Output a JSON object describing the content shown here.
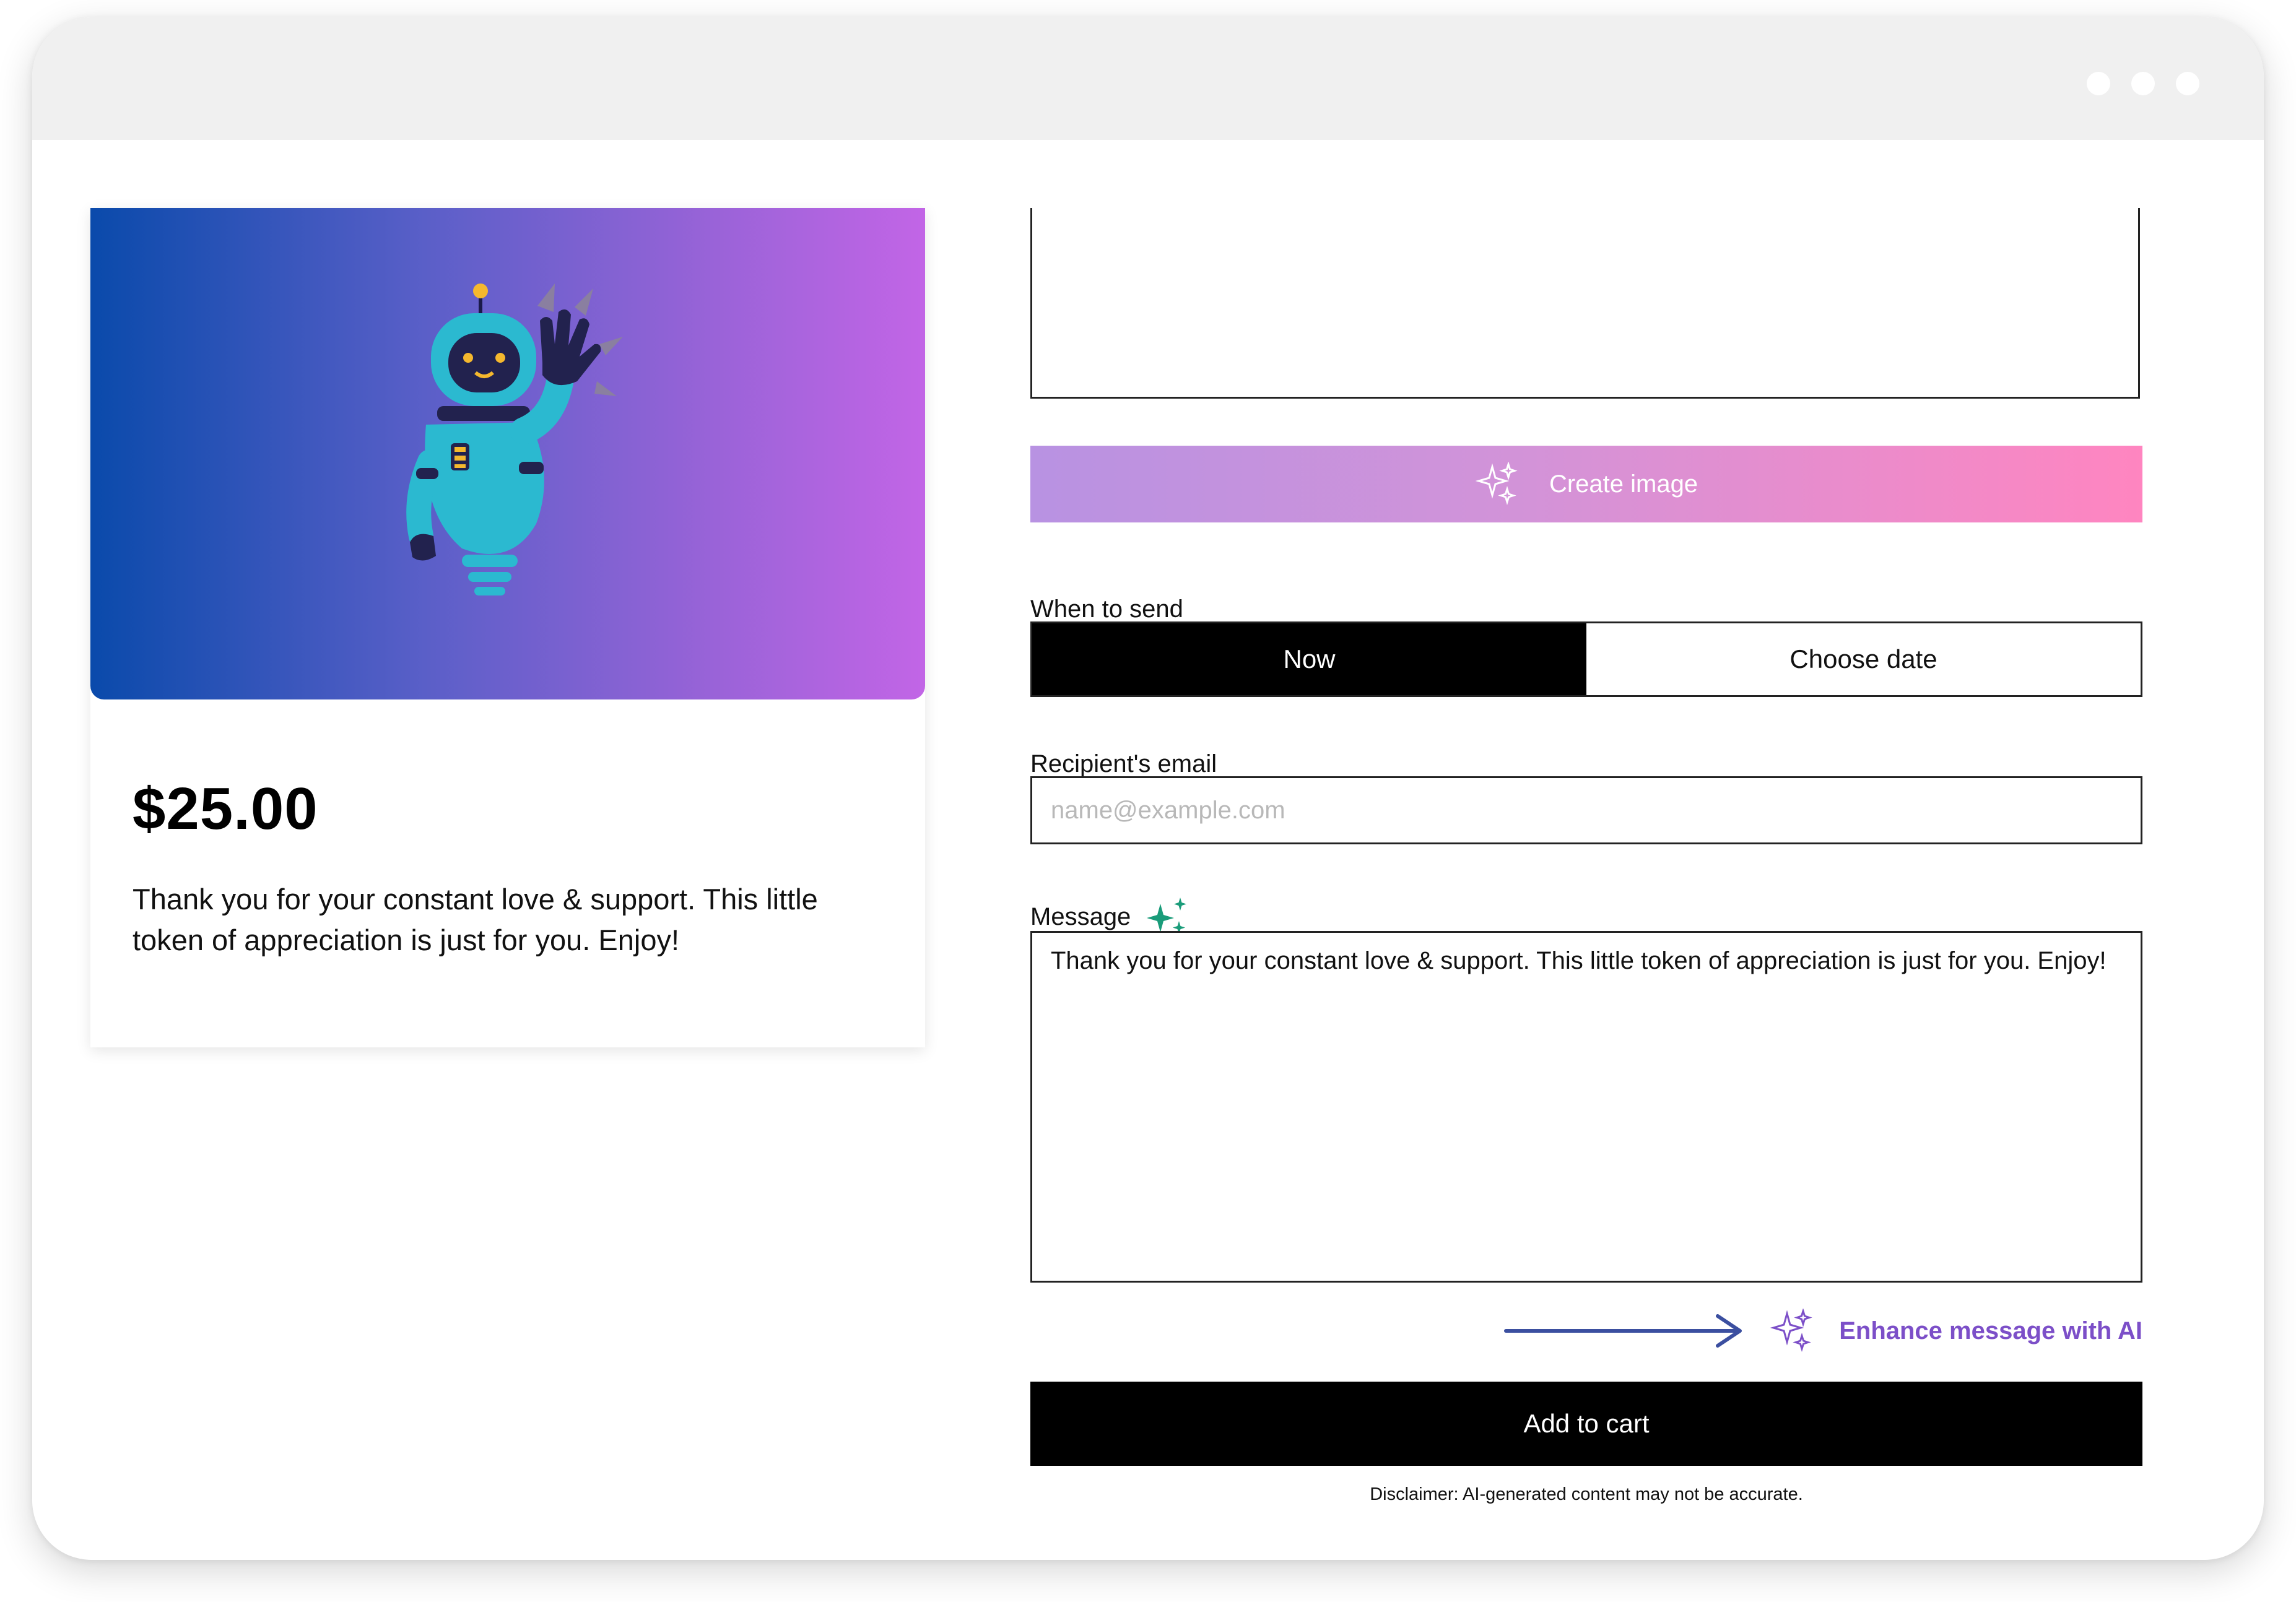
{
  "window": {
    "controls": [
      "dot-icon",
      "dot-icon",
      "dot-icon"
    ]
  },
  "card": {
    "image_icon": "robot-waving-illustration",
    "price": "$25.00",
    "message": "Thank you for your constant love & support. This little token of appreciation is just for you. Enjoy!"
  },
  "form": {
    "create_image_label": "Create image",
    "create_image_icon": "sparkles-icon",
    "when_to_send_label": "When to send",
    "send_options": [
      "Now",
      "Choose date"
    ],
    "send_selected": "Now",
    "recipient_label": "Recipient's email",
    "recipient_placeholder": "name@example.com",
    "recipient_value": "",
    "message_label": "Message",
    "message_icon": "sparkles-icon",
    "message_value": "Thank you for your constant love & support. This little token of appreciation is just for you. Enjoy!",
    "enhance_label": "Enhance message with AI",
    "enhance_icon": "sparkles-icon",
    "add_to_cart_label": "Add to cart",
    "disclaimer": "Disclaimer: AI-generated content may not be accurate."
  },
  "colors": {
    "accent_purple": "#7c4fc8",
    "create_gradient_start": "#b892e2",
    "create_gradient_end": "#ff85c0",
    "card_gradient_start": "#0a4aab",
    "card_gradient_end": "#c265e6",
    "sparkle_green": "#1a9c7a",
    "arrow_blue": "#3b4fa0"
  }
}
